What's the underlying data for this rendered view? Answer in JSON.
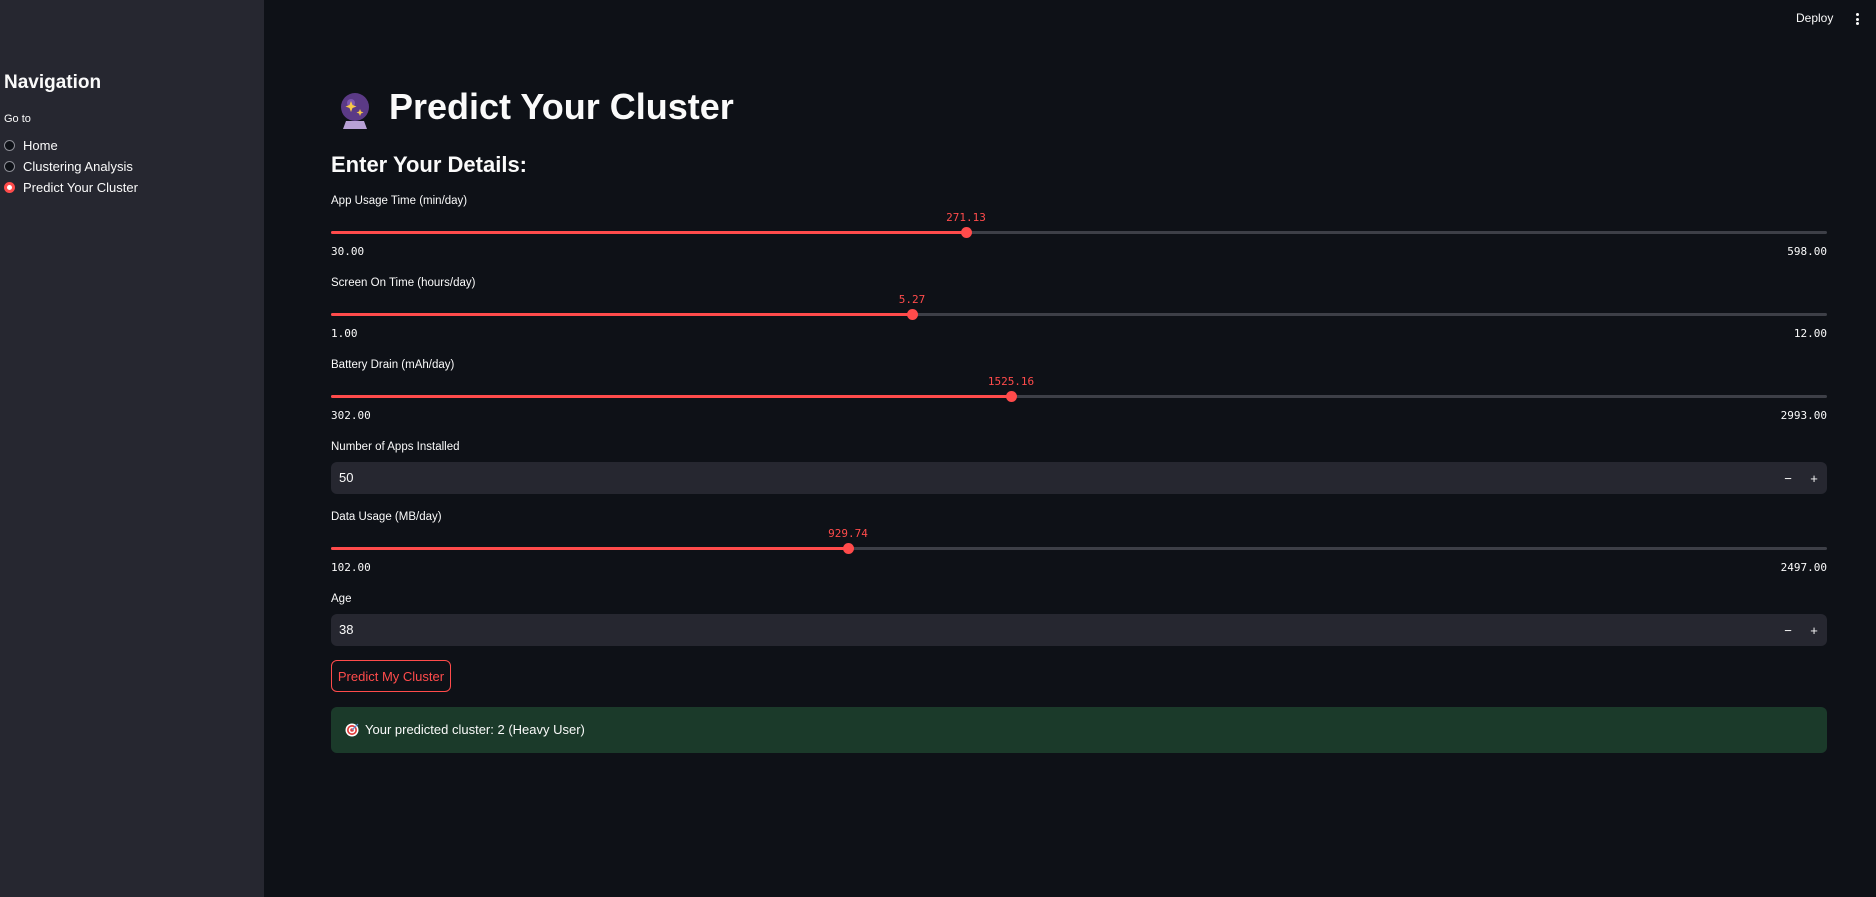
{
  "header": {
    "deploy_label": "Deploy"
  },
  "sidebar": {
    "title": "Navigation",
    "goto_label": "Go to",
    "items": [
      {
        "label": "Home",
        "selected": false
      },
      {
        "label": "Clustering Analysis",
        "selected": false
      },
      {
        "label": "Predict Your Cluster",
        "selected": true
      }
    ]
  },
  "main": {
    "title": "Predict Your Cluster",
    "title_icon": "crystal-ball-icon",
    "subheader": "Enter Your Details:",
    "app_usage": {
      "label": "App Usage Time (min/day)",
      "value": "271.13",
      "min": "30.00",
      "max": "598.00"
    },
    "screen_on": {
      "label": "Screen On Time (hours/day)",
      "value": "5.27",
      "min": "1.00",
      "max": "12.00"
    },
    "battery": {
      "label": "Battery Drain (mAh/day)",
      "value": "1525.16",
      "min": "302.00",
      "max": "2993.00"
    },
    "apps_installed": {
      "label": "Number of Apps Installed",
      "value": "50"
    },
    "data_usage": {
      "label": "Data Usage (MB/day)",
      "value": "929.74",
      "min": "102.00",
      "max": "2497.00"
    },
    "age": {
      "label": "Age",
      "value": "38"
    },
    "minus_label": "−",
    "plus_label": "+",
    "predict_button": "Predict My Cluster",
    "result_icon": "target-icon",
    "result_text": "Your predicted cluster: 2 (Heavy User)"
  },
  "colors": {
    "background": "#0e1117",
    "sidebar": "#262730",
    "accent": "#ff4b4b",
    "success_bg": "#1b3a2a"
  }
}
